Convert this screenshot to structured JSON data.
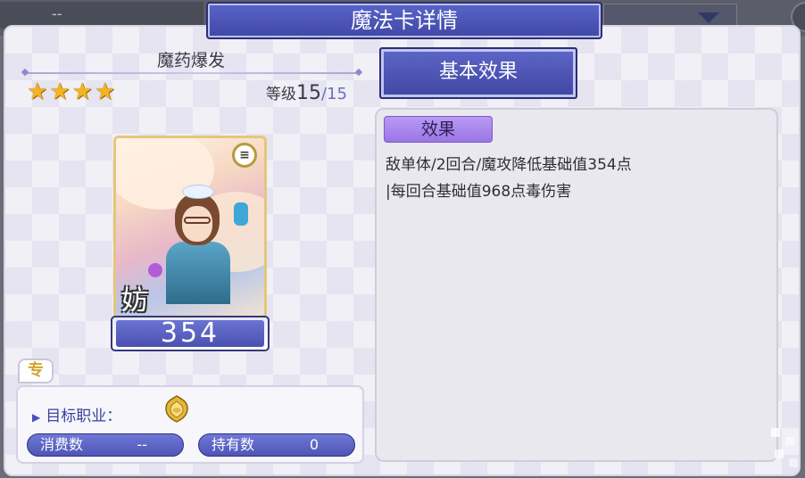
{
  "background": {
    "left_bar_text": "--"
  },
  "dialog": {
    "title": "魔法卡详情"
  },
  "card": {
    "name": "魔药爆发",
    "stars": 4,
    "level_label": "等级",
    "level": "15",
    "level_sep": "/",
    "level_max": "15",
    "rank_badge": "≡",
    "art_label": "妨",
    "value": "354",
    "type_tag": "专"
  },
  "target": {
    "label": "目标职业：",
    "consume_label": "消费数",
    "consume_value": "--",
    "hold_label": "持有数",
    "hold_value": "0"
  },
  "effects": {
    "tab_label": "基本效果",
    "badge": "效果",
    "line1": "敌单体/2回合/魔攻降低基础值354点",
    "line2": "|每回合基础值968点毒伤害"
  },
  "colors": {
    "accent": "#4a50b0",
    "star": "#f2b425",
    "effect_badge": "#9a76e6"
  }
}
